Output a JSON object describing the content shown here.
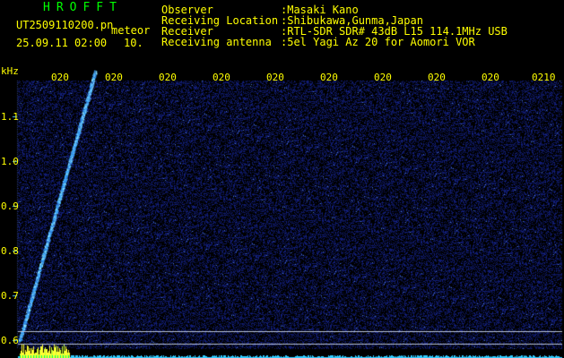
{
  "header": {
    "brand": "HROFFT",
    "filename": "UT2509110200.pn",
    "tag": "meteor",
    "datetime": "25.09.11 02:00",
    "duration": "10.",
    "info": [
      {
        "label": "Observer",
        "value": ":Masaki Kano"
      },
      {
        "label": "Receiving Location",
        "value": ":Shibukawa,Gunma,Japan"
      },
      {
        "label": "Receiver",
        "value": ":RTL-SDR SDR# 43dB L15 114.1MHz USB"
      },
      {
        "label": "Receiving antenna",
        "value": ":5el Yagi Az 20 for Aomori VOR"
      }
    ]
  },
  "chart_data": {
    "type": "heatmap",
    "ylabel": "kHz",
    "yticks": [
      "1.1",
      "1.0",
      "0.9",
      "0.8",
      "0.7",
      "0.6"
    ],
    "ylim": [
      0.6,
      1.15
    ],
    "xticks": [
      "020",
      "020",
      "020",
      "020",
      "020",
      "020",
      "020",
      "020",
      "020",
      "0210"
    ],
    "meteor_trace": {
      "start_x_tick_index": 0,
      "start_freq_khz": 0.6,
      "end_x_tick_index": 0.6,
      "end_freq_khz": 1.2
    }
  },
  "colors": {
    "label_text": "#ffff00",
    "brand_text": "#00ff00",
    "background": "#000000",
    "noise": "#1a2a6e",
    "signal": "#3aa8ff",
    "baseline": "#33ccff"
  }
}
